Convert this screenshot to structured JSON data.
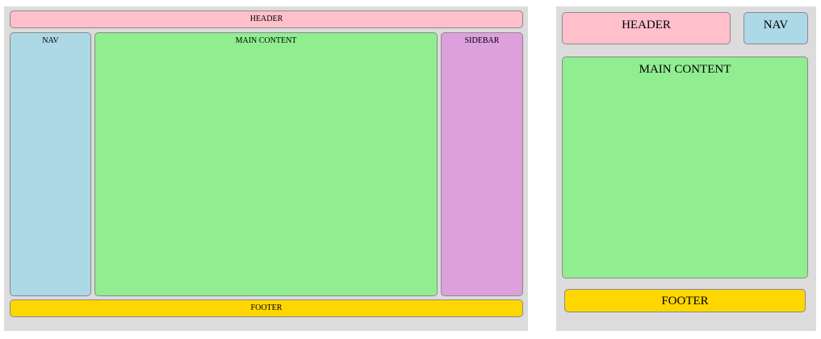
{
  "colors": {
    "canvas": "#dcdcdc",
    "header": "#ffc0cb",
    "nav": "#add8e6",
    "main": "#90ee90",
    "sidebar": "#dda0dd",
    "footer": "#ffd700"
  },
  "wide_layout": {
    "header": "HEADER",
    "nav": "NAV",
    "main": "MAIN CONTENT",
    "sidebar": "SIDEBAR",
    "footer": "FOOTER"
  },
  "narrow_layout": {
    "header": "HEADER",
    "nav": "NAV",
    "main": "MAIN CONTENT",
    "footer": "FOOTER"
  }
}
